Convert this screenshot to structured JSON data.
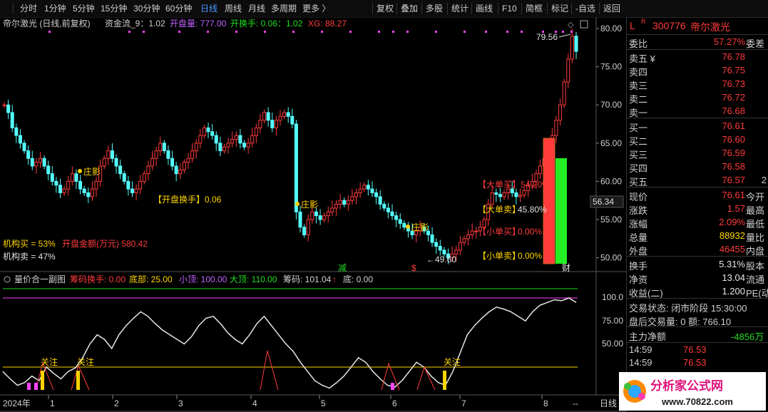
{
  "toolbar": {
    "tabs": [
      "分时",
      "1分钟",
      "5分钟",
      "15分钟",
      "30分钟",
      "60分钟",
      "日线",
      "周线",
      "月线",
      "多周期",
      "更多 〉"
    ],
    "active_tab": "日线",
    "actions": [
      "复权",
      "叠加",
      "多股",
      "统计",
      "画线",
      "F10",
      "简框",
      "标记",
      "-自选",
      "返回"
    ]
  },
  "main_header": {
    "stock_label": "帝尔激光 (日线,前复权)",
    "indicator": "资金流_9：1.02",
    "kp_label": "开盘量: 777.00",
    "kphs_label": "开换手: 0.06：1.02",
    "xg_label": "XG: 88.27"
  },
  "annotations": {
    "zhuangying": "庄影",
    "kaipan_huanshou": "【开盘换手】0.06",
    "jigou_mai": "机构买 = 53%",
    "kaipan_jine": "开盘金额(万元) 580.42",
    "jigou_mai2": "机构卖 = 47%",
    "da_mai": "【大单买】54.20%",
    "da_mai_short": "【大单买】",
    "da_mai_val": "54.20%",
    "da_mai2_label": "【大单卖】",
    "da_mai2_val": "45.80%",
    "xiao_mai_label": "【小单买】",
    "xiao_mai_val": "0.00%",
    "xiao_mai2_label": "【小单卖】",
    "xiao_mai2_val": "0.00%",
    "high_mark": "79.56",
    "low_mark": "49.60",
    "right_mark": "56.34",
    "jian": "减",
    "s_mark": "$",
    "cai": "财"
  },
  "sub_header": {
    "title": "量价合一副图",
    "chouma_huanshou": "筹码换手: 0.00",
    "dibu": "底部: 25.00",
    "xiaoding": "小顶: 100.00",
    "dading": "大顶: 110.00",
    "chouma": "筹码: 101.04",
    "di": "底: 0.00",
    "guanzhu": "关注"
  },
  "x_axis": {
    "year": "2024年",
    "months": [
      "1",
      "2",
      "3",
      "4",
      "5",
      "6",
      "7",
      "8"
    ],
    "scroll": "--",
    "period": "日线"
  },
  "y_axis_main": [
    "80.00",
    "75.00",
    "70.00",
    "65.00",
    "60.00",
    "55.00",
    "50.00"
  ],
  "y_axis_sub": [
    "100.0",
    "75.00",
    "50.00"
  ],
  "side": {
    "code_prefix": "L",
    "code": "300776",
    "name": "帝尔激光",
    "weibi_label": "委比",
    "weibi": "57.27%",
    "weicha_label": "委差",
    "asks": [
      {
        "l": "卖五 ¥",
        "p": "76.78"
      },
      {
        "l": "卖四",
        "p": "76.75"
      },
      {
        "l": "卖三",
        "p": "76.73"
      },
      {
        "l": "卖二",
        "p": "76.72"
      },
      {
        "l": "卖一",
        "p": "76.68"
      }
    ],
    "bids": [
      {
        "l": "买一",
        "p": "76.61"
      },
      {
        "l": "买二",
        "p": "76.60"
      },
      {
        "l": "买三",
        "p": "76.59"
      },
      {
        "l": "买四",
        "p": "76.58"
      },
      {
        "l": "买五",
        "p": "76.57",
        "n": "2"
      }
    ],
    "stats": [
      {
        "l": "现价",
        "v": "76.61",
        "l2": "今开"
      },
      {
        "l": "涨跌",
        "v": "1.57",
        "l2": "最高"
      },
      {
        "l": "涨幅",
        "v": "2.09%",
        "l2": "最低"
      },
      {
        "l": "总量",
        "v": "88932",
        "l2": "量比"
      },
      {
        "l": "外盘",
        "v": "46455",
        "l2": "内盘"
      }
    ],
    "stats2": [
      {
        "l": "换手",
        "v": "5.31%",
        "l2": "股本"
      },
      {
        "l": "净资",
        "v": "13.04",
        "l2": "流通"
      },
      {
        "l": "收益(二)",
        "v": "1.200",
        "l2": "PE(动)"
      }
    ],
    "status": "交易状态: 闭市阶段 15:30:00",
    "after": "盘后交易量: 0  额: 766.10",
    "net_label": "主力净额",
    "net_value": "-4856万",
    "ticks": [
      {
        "t": "14:59",
        "p": "76.53"
      },
      {
        "t": "14:59",
        "p": "76.53"
      },
      {
        "t": "14:59",
        "p": "76.53"
      }
    ]
  },
  "logo": {
    "text": "分析家公式网",
    "url": "www.70822.com"
  },
  "colors": {
    "up": "#ff3b3b",
    "down": "#54ffff",
    "accent": "#4a9cff",
    "yellow": "#ffd400",
    "magenta": "#ff44ff",
    "green": "#22dd22"
  }
}
